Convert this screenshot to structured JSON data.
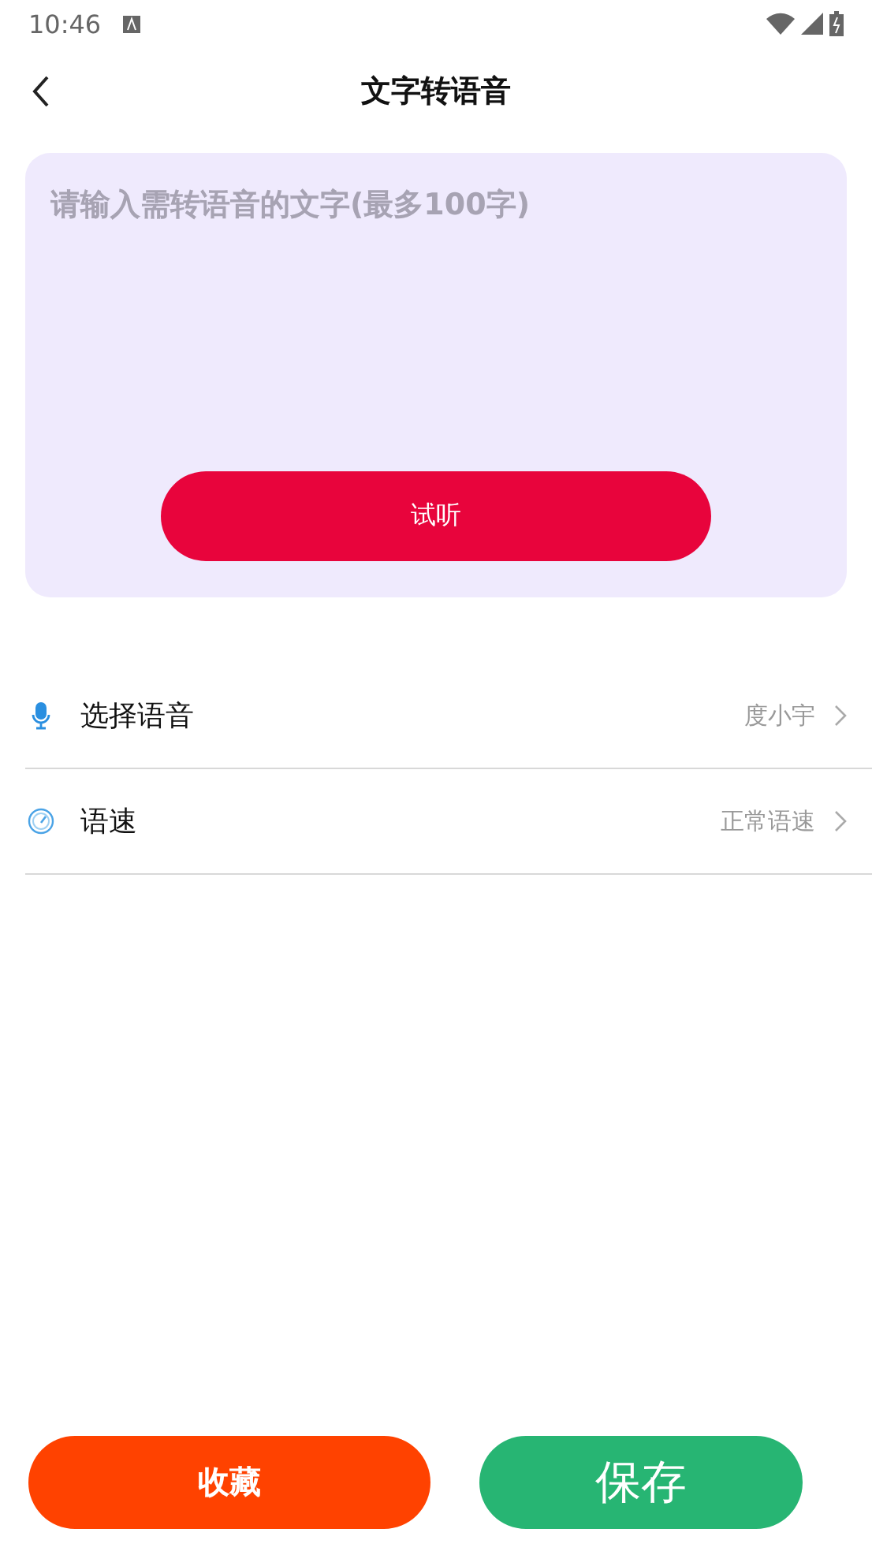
{
  "status_bar": {
    "time": "10:46"
  },
  "header": {
    "title": "文字转语音"
  },
  "input": {
    "placeholder": "请输入需转语音的文字(最多100字)"
  },
  "listen_button": "试听",
  "settings": [
    {
      "kind": "voice",
      "label": "选择语音",
      "value": "度小宇"
    },
    {
      "kind": "speed",
      "label": "语速",
      "value": "正常语速"
    }
  ],
  "actions": [
    {
      "kind": "favorite",
      "label": "收藏"
    },
    {
      "kind": "save",
      "label": "保存"
    }
  ]
}
